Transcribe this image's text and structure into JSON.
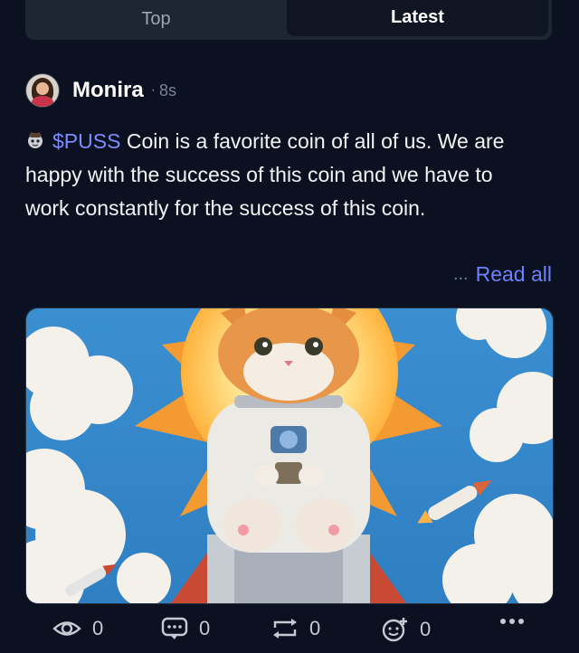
{
  "tabs": [
    {
      "label": "Top",
      "active": false
    },
    {
      "label": "Latest",
      "active": true
    }
  ],
  "post": {
    "author": "Monira",
    "separator": "·",
    "time": "8s",
    "ticker": "$PUSS",
    "text": " Coin is a favorite coin of all of us. We are happy with the success of this coin and we have to work constantly for the success of this coin.",
    "read_more_ellipsis": "...",
    "read_more_label": "Read all",
    "image_icon": "cat-astronaut-rocket-image"
  },
  "actions": {
    "views": "0",
    "comments": "0",
    "reposts": "0",
    "reactions": "0"
  },
  "colors": {
    "background": "#0b1120",
    "accent": "#6f80ff",
    "muted": "#7c8494"
  }
}
